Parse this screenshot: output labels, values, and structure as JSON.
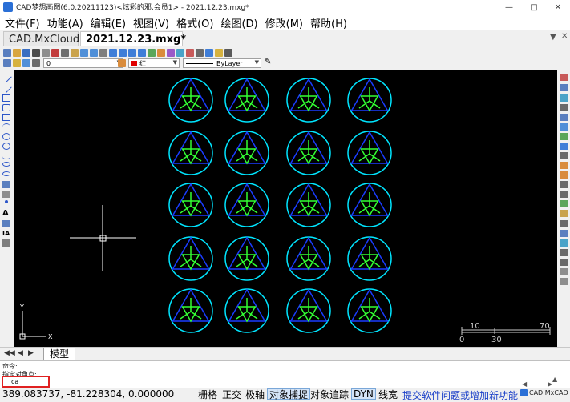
{
  "window": {
    "title": "CAD梦想画图(6.0.20211123)<炫彩的邪,会员1> - 2021.12.23.mxg*",
    "controls": [
      "minimize-icon",
      "maximize-icon",
      "close-icon"
    ]
  },
  "menu": [
    "文件(F)",
    "功能(A)",
    "编辑(E)",
    "视图(V)",
    "格式(O)",
    "绘图(D)",
    "修改(M)",
    "帮助(H)"
  ],
  "tabs": [
    {
      "label": "CAD.MxCloud",
      "active": false
    },
    {
      "label": "2021.12.23.mxg*",
      "active": true
    }
  ],
  "layer_combo": {
    "value": "0"
  },
  "color_combo": {
    "value": "红",
    "swatch": "#e00000"
  },
  "linetype_combo": {
    "value": "ByLayer"
  },
  "drawing": {
    "background": "#000000",
    "circle_color": "#00e5ff",
    "triangle_color": "#1a3cff",
    "inner_color": "#33ff33",
    "rows": 5,
    "cols": 4,
    "ucs_labels": {
      "x": "X",
      "y": "Y"
    },
    "scale_labels": {
      "top_left": "10",
      "top_right": "70",
      "bottom_left": "0",
      "bottom_mid": "30"
    }
  },
  "model_tab": {
    "label": "模型"
  },
  "command": {
    "line1": "命令:",
    "line2": "指定对角点:",
    "input": "ca"
  },
  "status": {
    "coords": "389.083737,  -81.228304, 0.000000",
    "buttons": [
      {
        "label": "栅格",
        "on": false
      },
      {
        "label": "正交",
        "on": false
      },
      {
        "label": "极轴",
        "on": false
      },
      {
        "label": "对象捕捉",
        "on": true
      },
      {
        "label": "对象追踪",
        "on": false
      },
      {
        "label": "DYN",
        "on": true
      },
      {
        "label": "线宽",
        "on": false
      }
    ],
    "feedback": "提交软件问题或增加新功能",
    "brand": "CAD.MxCAD"
  }
}
